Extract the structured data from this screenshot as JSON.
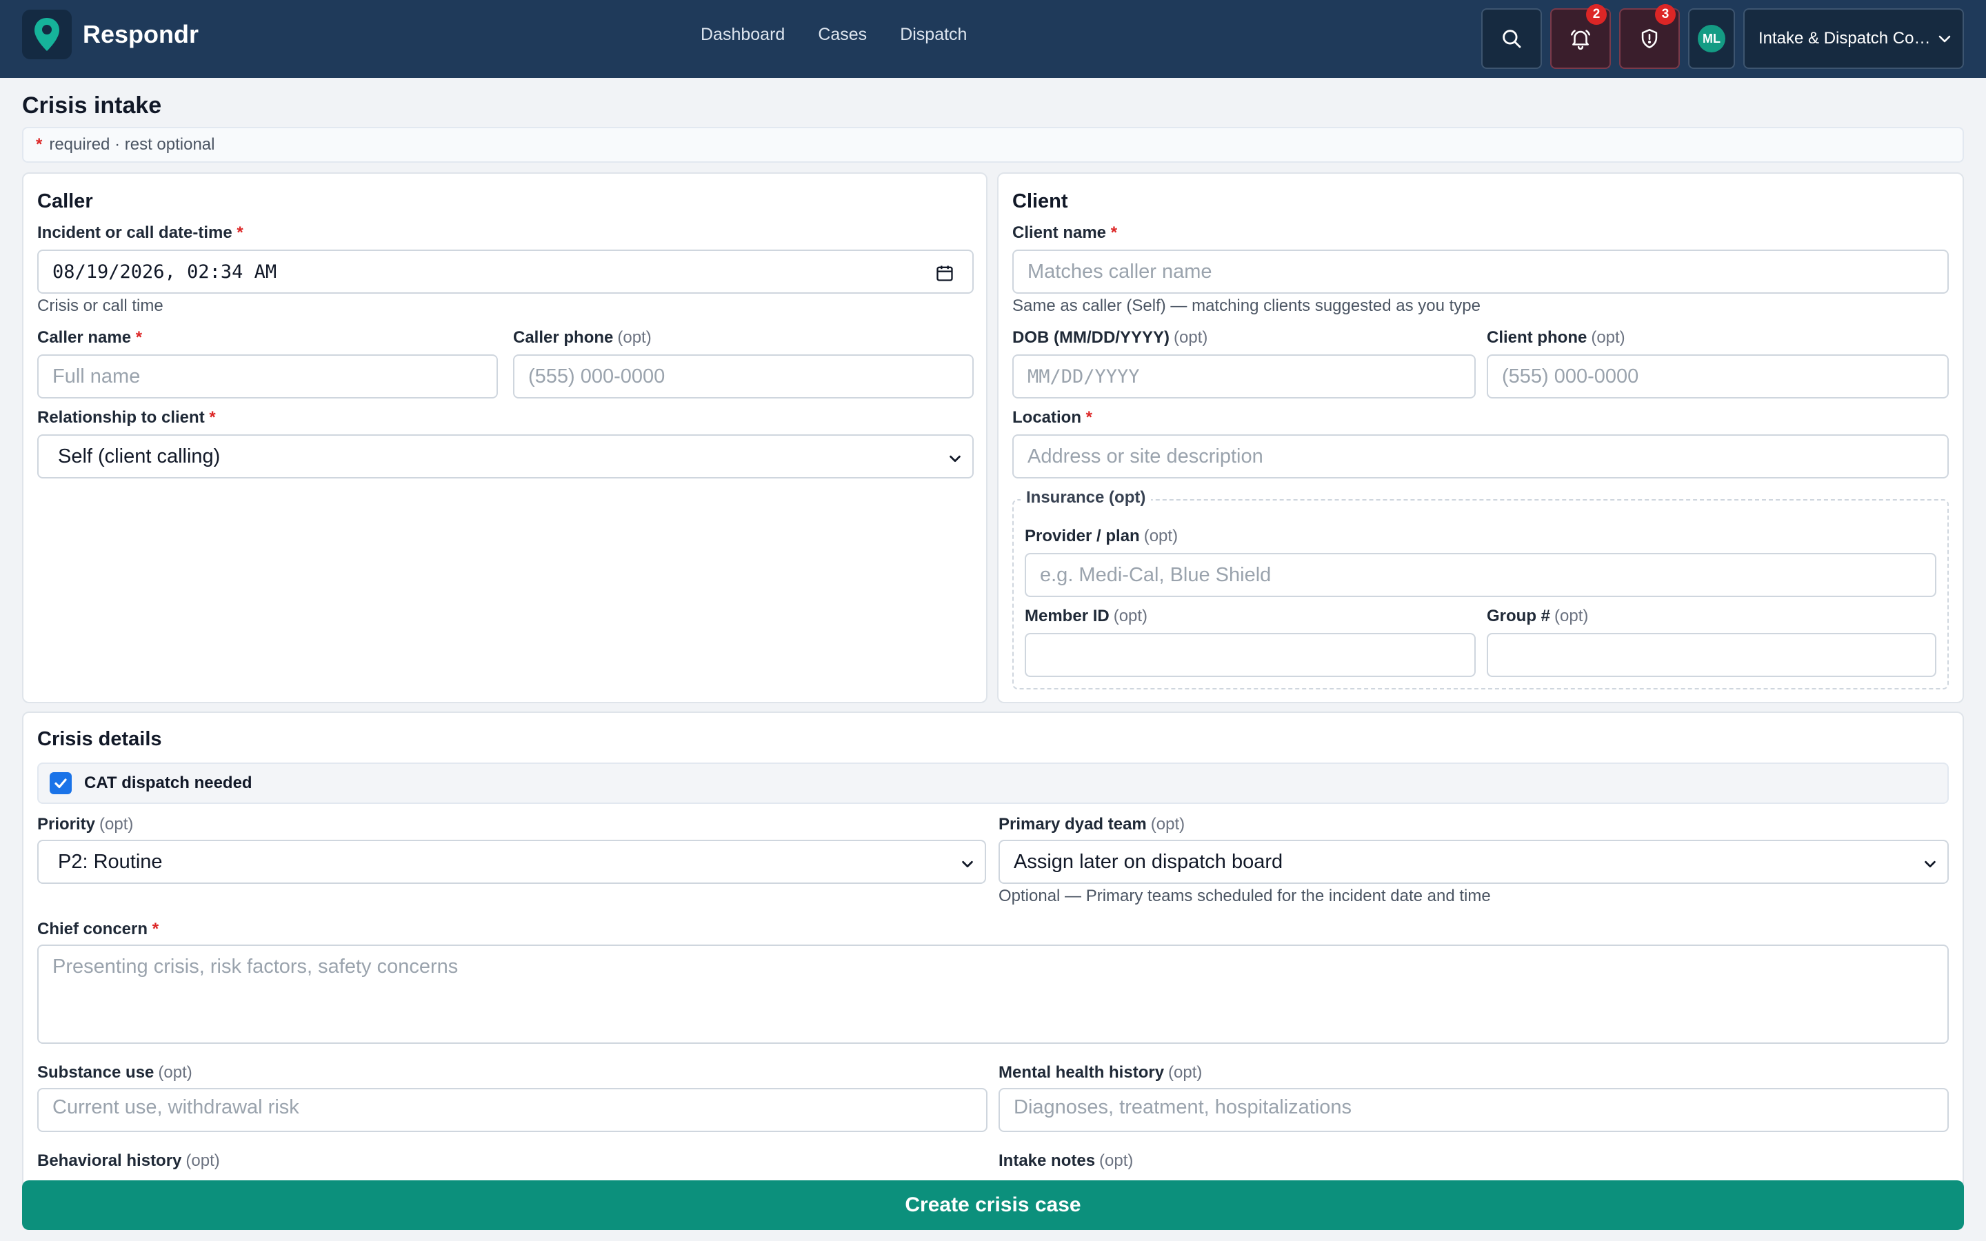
{
  "app": {
    "name": "Respondr",
    "nav": [
      "Dashboard",
      "Cases",
      "Dispatch"
    ],
    "notifications_count": "2",
    "alerts_count": "3",
    "user_initials": "ML",
    "role": "Intake & Dispatch Coordinator",
    "accent": "#0c907c",
    "header_bg": "#1f3a5a"
  },
  "page": {
    "title": "Crisis intake",
    "required_marker": "*",
    "legend": "required · rest optional"
  },
  "common": {
    "req": "*",
    "opt": "(opt)"
  },
  "caller": {
    "title": "Caller",
    "datetime_label": "Incident or call date-time",
    "datetime_value": "08/19/2026, 02:34 AM",
    "datetime_hint": "Crisis or call time",
    "name_label": "Caller name",
    "name_placeholder": "Full name",
    "phone_label": "Caller phone",
    "phone_placeholder": "(555) 000-0000",
    "relationship_label": "Relationship to client",
    "relationship_value": "Self (client calling)"
  },
  "client": {
    "title": "Client",
    "name_label": "Client name",
    "name_placeholder": "Matches caller name",
    "name_hint": "Same as caller (Self) — matching clients suggested as you type",
    "dob_label": "DOB (MM/DD/YYYY)",
    "dob_placeholder": "MM/DD/YYYY",
    "phone_label": "Client phone",
    "phone_placeholder": "(555) 000-0000",
    "location_label": "Location",
    "location_placeholder": "Address or site description",
    "insurance_legend": "Insurance (opt)",
    "provider_label": "Provider / plan",
    "provider_placeholder": "e.g. Medi-Cal, Blue Shield",
    "member_label": "Member ID",
    "group_label": "Group #"
  },
  "crisis": {
    "title": "Crisis details",
    "cat_dispatch_label": "CAT dispatch needed",
    "cat_dispatch_checked": true,
    "priority_label": "Priority",
    "priority_value": "P2: Routine",
    "team_label": "Primary dyad team",
    "team_value": "Assign later on dispatch board",
    "team_hint": "Optional — Primary teams scheduled for the incident date and time",
    "concern_label": "Chief concern",
    "concern_placeholder": "Presenting crisis, risk factors, safety concerns",
    "substance_label": "Substance use",
    "substance_placeholder": "Current use, withdrawal risk",
    "mental_label": "Mental health history",
    "mental_placeholder": "Diagnoses, treatment, hospitalizations",
    "behavioral_label": "Behavioral history",
    "notes_label": "Intake notes"
  },
  "submit_label": "Create crisis case"
}
